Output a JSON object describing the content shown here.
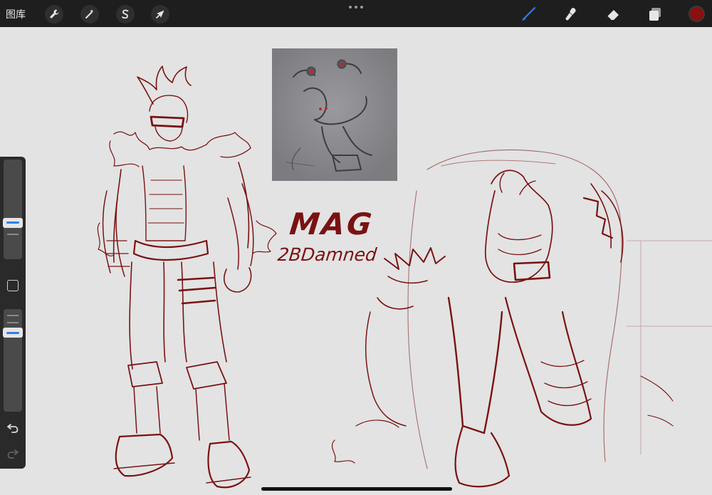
{
  "topbar": {
    "gallery_label": "图库",
    "tools": [
      {
        "name": "actions",
        "icon": "wrench-icon"
      },
      {
        "name": "adjustments",
        "icon": "magic-wand-icon"
      },
      {
        "name": "selection",
        "icon": "selection-s-icon"
      },
      {
        "name": "transform",
        "icon": "arrow-cursor-icon"
      }
    ],
    "right_tools": [
      {
        "name": "brush",
        "icon": "brush-icon",
        "active": true
      },
      {
        "name": "smudge",
        "icon": "smudge-icon"
      },
      {
        "name": "eraser",
        "icon": "eraser-icon"
      },
      {
        "name": "layers",
        "icon": "layers-icon"
      }
    ],
    "current_color": "#8a0f0f",
    "active_color": "#2f7fe8"
  },
  "canvas": {
    "background": "#e3e3e3",
    "ink_color": "#7a1212",
    "title_text": "MAG",
    "subtitle_text": "2BDamned"
  },
  "sidebar": {
    "brush_size_level": 0.35,
    "opacity_level": 0.2
  }
}
